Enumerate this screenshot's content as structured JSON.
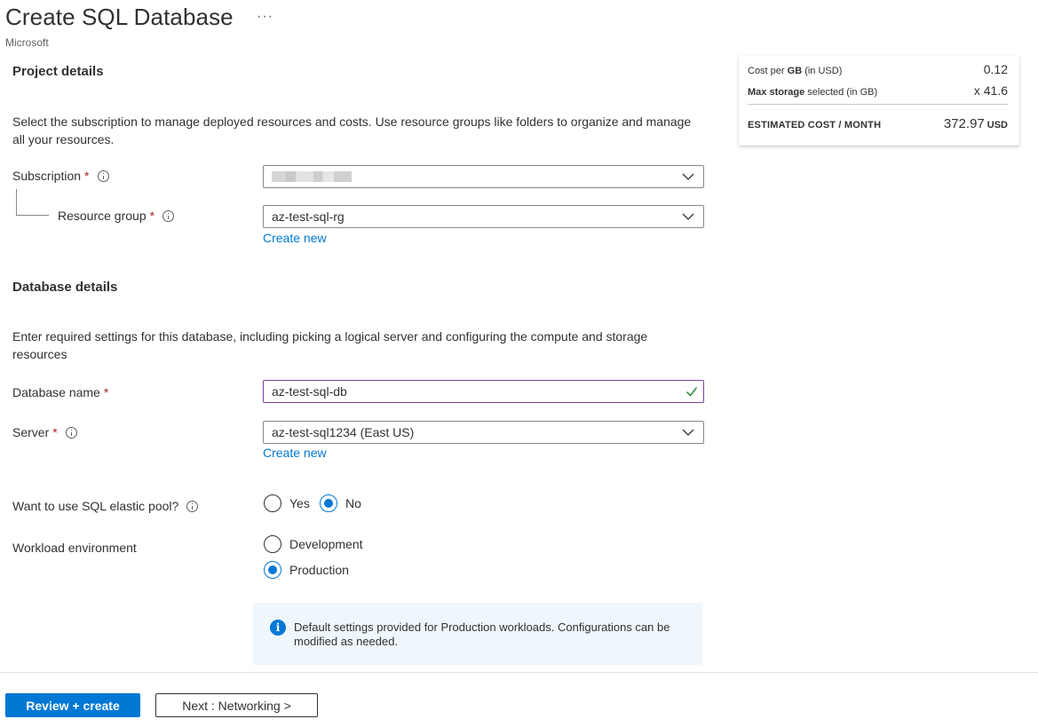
{
  "header": {
    "title": "Create SQL Database",
    "more_label": "···",
    "publisher": "Microsoft"
  },
  "project_details": {
    "title": "Project details",
    "description": "Select the subscription to manage deployed resources and costs. Use resource groups like folders to organize and manage all your resources.",
    "subscription": {
      "label": "Subscription",
      "required_mark": "*"
    },
    "resource_group": {
      "label": "Resource group",
      "required_mark": "*",
      "value": "az-test-sql-rg",
      "create_new": "Create new"
    }
  },
  "database_details": {
    "title": "Database details",
    "description": "Enter required settings for this database, including picking a logical server and configuring the compute and storage resources",
    "database_name": {
      "label": "Database name",
      "required_mark": "*",
      "value": "az-test-sql-db"
    },
    "server": {
      "label": "Server",
      "required_mark": "*",
      "value": "az-test-sql1234 (East US)",
      "create_new": "Create new"
    },
    "elastic_pool": {
      "label": "Want to use SQL elastic pool?",
      "options": [
        "Yes",
        "No"
      ],
      "selected": "No"
    },
    "workload": {
      "label": "Workload environment",
      "options": [
        "Development",
        "Production"
      ],
      "selected": "Production"
    },
    "info_message": "Default settings provided for Production workloads. Configurations can be modified as needed."
  },
  "cost_summary": {
    "cost_per_gb_bold": "GB",
    "cost_per_gb_prefix": "Cost per ",
    "cost_per_gb_suffix": " (in USD)",
    "cost_per_gb_value": "0.12",
    "max_storage_bold": "Max storage",
    "max_storage_suffix": " selected (in GB)",
    "max_storage_value": "x 41.6",
    "estimated_label": "ESTIMATED COST / MONTH",
    "estimated_value": "372.97",
    "estimated_unit": "USD"
  },
  "footer": {
    "review_create": "Review + create",
    "next": "Next : Networking >"
  },
  "colors": {
    "accent": "#0078d4",
    "required": "#a4262c",
    "valid": "#107c10"
  }
}
